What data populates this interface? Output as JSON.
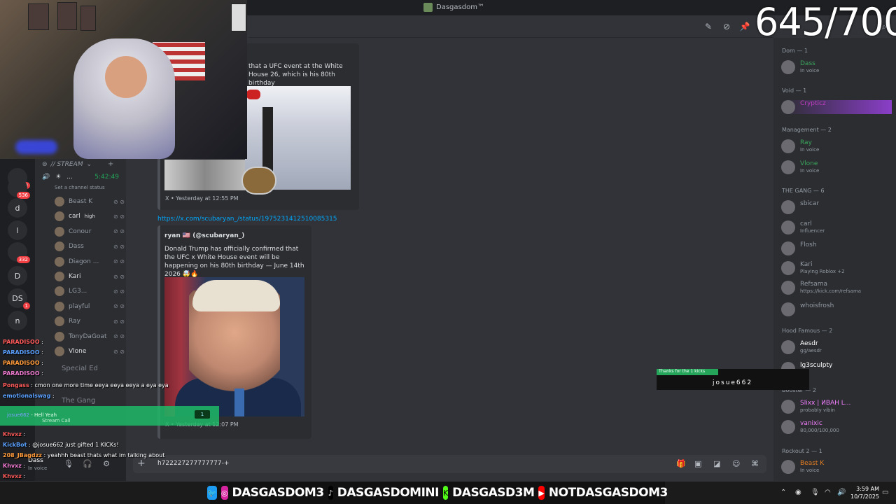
{
  "window": {
    "title": "Dasgasdom™"
  },
  "overlay": {
    "counter": "645/700"
  },
  "servers": [
    {
      "label": "",
      "badge": "98"
    },
    {
      "label": "",
      "badge": "536"
    },
    {
      "label": "d",
      "badge": ""
    },
    {
      "label": "l",
      "badge": ""
    },
    {
      "label": "",
      "badge": "332"
    },
    {
      "label": "D",
      "badge": ""
    },
    {
      "label": "DS",
      "badge": "1"
    },
    {
      "label": "n",
      "badge": ""
    }
  ],
  "channels": {
    "voice_header": "// STREAM",
    "stream_title": "...",
    "stream_time": "5:42:49",
    "channel_status": "Set a channel status",
    "voice_users": [
      {
        "name": "Beast K",
        "tag": ""
      },
      {
        "name": "carl",
        "tag": "high"
      },
      {
        "name": "Conour",
        "tag": ""
      },
      {
        "name": "Dass",
        "tag": ""
      },
      {
        "name": "Diagon ...",
        "tag": ""
      },
      {
        "name": "Kari",
        "tag": ""
      },
      {
        "name": "LG3...",
        "tag": ""
      },
      {
        "name": "playful",
        "tag": ""
      },
      {
        "name": "Ray",
        "tag": ""
      },
      {
        "name": "TonyDaGoat",
        "tag": ""
      },
      {
        "name": "Vlone",
        "tag": ""
      }
    ],
    "text_channels": [
      "Special Ed",
      "The Gang"
    ]
  },
  "chat": {
    "lines": [
      {
        "user": "PARADISOO",
        "text": ":"
      },
      {
        "user": "PARADISOO",
        "text": ":"
      },
      {
        "user": "PARADISOO",
        "text": ":"
      },
      {
        "user": "PARADISOO",
        "text": ":"
      },
      {
        "user": "Pongass",
        "text": ": cmon one more time eeya eeya eeya a eya eya"
      },
      {
        "user": "emotionalswag",
        "text": ":"
      }
    ],
    "alert_user": "josue662",
    "alert_text": "Hell Yeah",
    "alert_sub": "Stream Call",
    "alert_badge": "1",
    "lines2": [
      {
        "user": "Khvxz",
        "text": ":"
      },
      {
        "user": "KickBot",
        "text": ": @josue662 just gifted 1 KICKs!"
      },
      {
        "user": "208_JBagdzz",
        "text": ": yeahhh beast thats what im talking about"
      },
      {
        "user": "Khvxz",
        "text": ":"
      },
      {
        "user": "Khvxz",
        "text": ":"
      }
    ]
  },
  "user_panel": {
    "name": "Dass",
    "status": "In voice"
  },
  "messages": {
    "embed1_text": "that a UFC event at the White House 26, which is his 80th birthday",
    "embed1_footer": "X • Yesterday at 12:55 PM",
    "link2": "https://x.com/scubaryan_/status/1975231412510085315",
    "embed2_author": "ryan 🇺🇸 (@scubaryan_)",
    "embed2_text": "Donald Trump has officially confirmed that the UFC x White House event will be happening on his 80th birthday — June 14th 2026 🤯🔥",
    "embed2_footer": "X • Yesterday at 12:07 PM"
  },
  "composer": {
    "value": "h722227277777777-+"
  },
  "members": {
    "groups": [
      {
        "title": "Dom — 1",
        "users": [
          {
            "name": "Dass",
            "sub": "In voice",
            "color": "#3ba55c"
          }
        ]
      },
      {
        "title": "Void — 1",
        "users": [
          {
            "name": "Crypticz",
            "sub": "",
            "color": "#c03ec0"
          }
        ]
      },
      {
        "title": "Management — 2",
        "users": [
          {
            "name": "Ray",
            "sub": "In voice",
            "color": "#3ba55c"
          },
          {
            "name": "Vlone",
            "sub": "In voice",
            "color": "#3ba55c"
          }
        ]
      },
      {
        "title": "THE GANG — 6",
        "users": [
          {
            "name": "sbicar",
            "sub": "",
            "color": "#949ba4"
          },
          {
            "name": "carl",
            "sub": "Influencer",
            "color": "#949ba4"
          },
          {
            "name": "Flosh",
            "sub": "",
            "color": "#949ba4"
          },
          {
            "name": "Kari",
            "sub": "Playing Roblox +2",
            "color": "#949ba4"
          },
          {
            "name": "Refsama",
            "sub": "https://kick.com/refsama",
            "color": "#949ba4"
          },
          {
            "name": "whoisfrosh",
            "sub": "",
            "color": "#949ba4"
          }
        ]
      },
      {
        "title": "Hood Famous — 2",
        "users": [
          {
            "name": "Aesdr",
            "sub": "gg/aesdr",
            "color": "#ffffff"
          },
          {
            "name": "lg3sculpty",
            "sub": "",
            "color": "#ffffff"
          }
        ]
      },
      {
        "title": "Booster — 2",
        "users": [
          {
            "name": "Slixx | ИВАН L...",
            "sub": "probably vibin",
            "color": "#f47fff"
          },
          {
            "name": "vanixic",
            "sub": "80,000/100,000",
            "color": "#f47fff"
          }
        ]
      },
      {
        "title": "Rockout 2 — 1",
        "users": [
          {
            "name": "Beast K",
            "sub": "In voice",
            "color": "#e67e22"
          }
        ]
      }
    ],
    "carl_tag": "high",
    "slixx_tag": "G*59"
  },
  "kick_alert": {
    "title": "Thanks for the 1 kicks",
    "user": "josue662"
  },
  "follow_bar": [
    "DASGASDOM3",
    "DASGASDOMINI",
    "DASGASD3M",
    "NOTDASGASDOM3"
  ],
  "taskbar": {
    "time": "3:59 AM",
    "date": "10/7/2025"
  }
}
